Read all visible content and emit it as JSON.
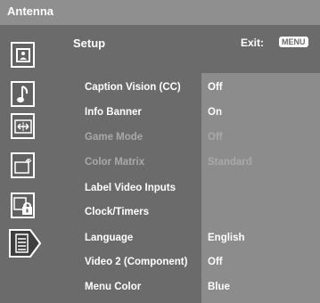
{
  "header": {
    "title": "Antenna"
  },
  "page": {
    "title": "Setup",
    "exit_label": "Exit:",
    "menu_badge": "MENU"
  },
  "sidebar": {
    "items": [
      {
        "icon": "picture-icon"
      },
      {
        "icon": "sound-note-icon"
      },
      {
        "icon": "screen-size-icon"
      },
      {
        "icon": "channel-icon"
      },
      {
        "icon": "parental-lock-icon"
      },
      {
        "icon": "setup-icon",
        "selected": true
      }
    ]
  },
  "menu": {
    "rows": [
      {
        "label": "Caption Vision (CC)",
        "value": "Off",
        "enabled": true
      },
      {
        "label": "Info Banner",
        "value": "On",
        "enabled": true
      },
      {
        "label": "Game Mode",
        "value": "Off",
        "enabled": false
      },
      {
        "label": "Color Matrix",
        "value": "Standard",
        "enabled": false
      },
      {
        "label": "Label Video Inputs",
        "value": "",
        "enabled": true
      },
      {
        "label": "Clock/Timers",
        "value": "",
        "enabled": true
      },
      {
        "label": "Language",
        "value": "English",
        "enabled": true
      },
      {
        "label": "Video 2 (Component)",
        "value": "Off",
        "enabled": true
      },
      {
        "label": "Menu Color",
        "value": "Blue",
        "enabled": true
      }
    ]
  },
  "colors": {
    "topbar": "#8f8f8f",
    "panel": "#6b6b6b",
    "value_panel": "#8c8c8c",
    "text": "#ffffff",
    "disabled_text": "#a9a9a9"
  }
}
